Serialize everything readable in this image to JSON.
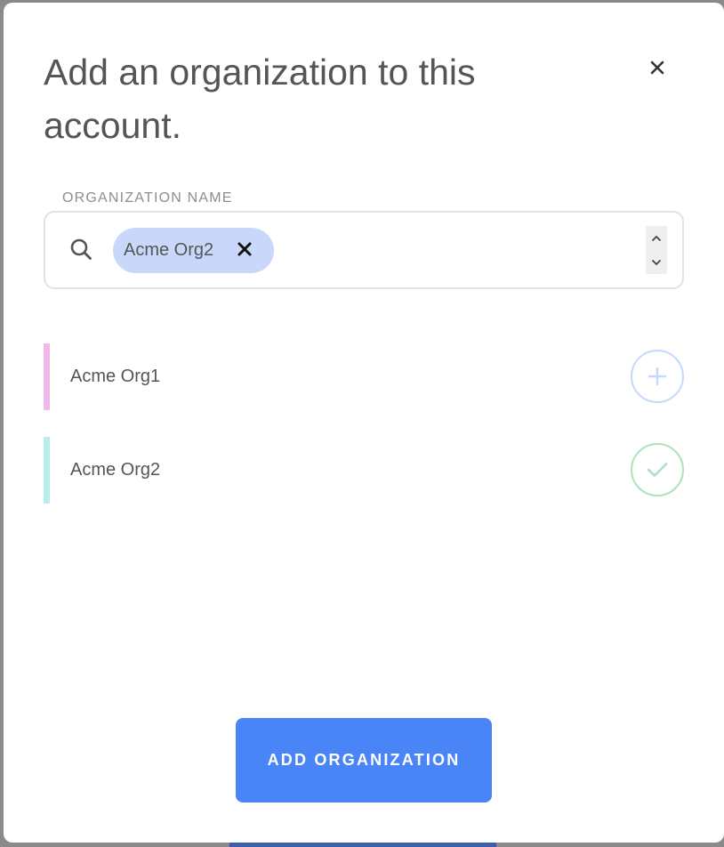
{
  "modal": {
    "title": "Add an organization to this account.",
    "close_icon": "close-icon"
  },
  "search": {
    "label": "ORGANIZATION NAME",
    "icon": "search-icon",
    "value": "",
    "selected_chips": [
      {
        "label": "Acme Org2",
        "remove_icon": "close-icon"
      }
    ],
    "spinner_up_icon": "chevron-up-icon",
    "spinner_down_icon": "chevron-down-icon"
  },
  "organizations": [
    {
      "name": "Acme Org1",
      "accent_color": "#f2b8ea",
      "status": "add",
      "action_icon": "plus-icon",
      "action_color": "#c6d8fc"
    },
    {
      "name": "Acme Org2",
      "accent_color": "#b8efed",
      "status": "selected",
      "action_icon": "check-icon",
      "action_color": "#ade2bd"
    }
  ],
  "actions": {
    "primary_label": "ADD ORGANIZATION",
    "primary_color": "#4a85f8"
  }
}
